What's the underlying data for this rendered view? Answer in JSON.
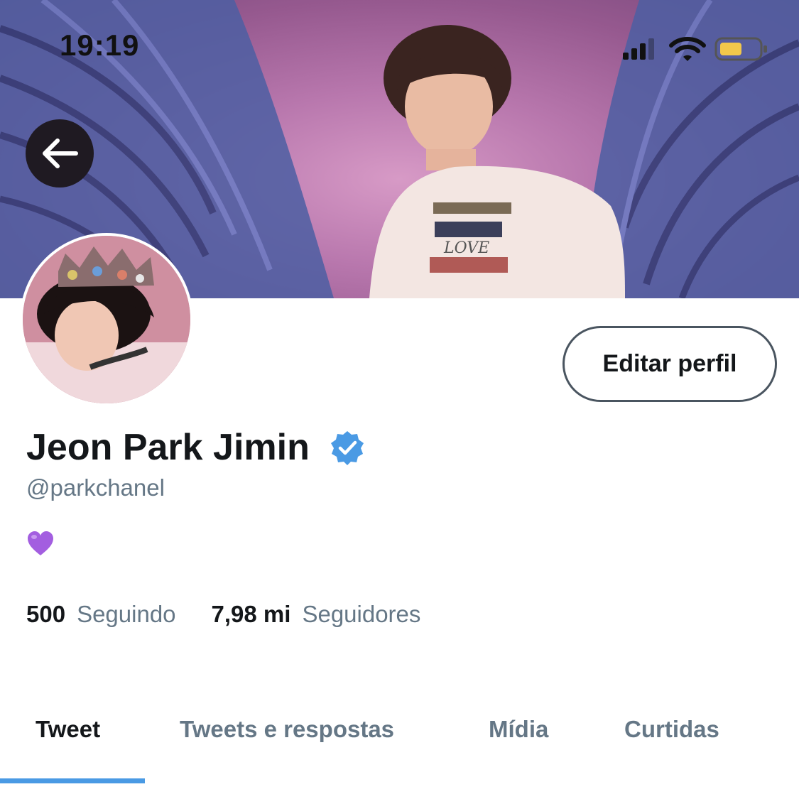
{
  "status_bar": {
    "time": "19:19",
    "icons": [
      "signal-icon",
      "wifi-icon",
      "battery-icon"
    ],
    "battery_color": "#f2c84b"
  },
  "header": {
    "back_icon": "arrow-left-icon"
  },
  "profile": {
    "edit_button_label": "Editar perfil",
    "name": "Jeon Park Jimin",
    "verified_icon": "verified-badge-icon",
    "verified_color": "#4a9ae4",
    "handle": "@parkchanel",
    "bio_emoji": "purple-heart-icon",
    "stats": [
      {
        "value": "500",
        "label": "Seguindo"
      },
      {
        "value": "7,98 mi",
        "label": "Seguidores"
      }
    ]
  },
  "tabs": [
    {
      "label": "Tweet",
      "active": true
    },
    {
      "label": "Tweets e respostas",
      "active": false
    },
    {
      "label": "Mídia",
      "active": false
    },
    {
      "label": "Curtidas",
      "active": false
    }
  ],
  "colors": {
    "accent": "#4a9ae4",
    "secondary_text": "#657786"
  }
}
